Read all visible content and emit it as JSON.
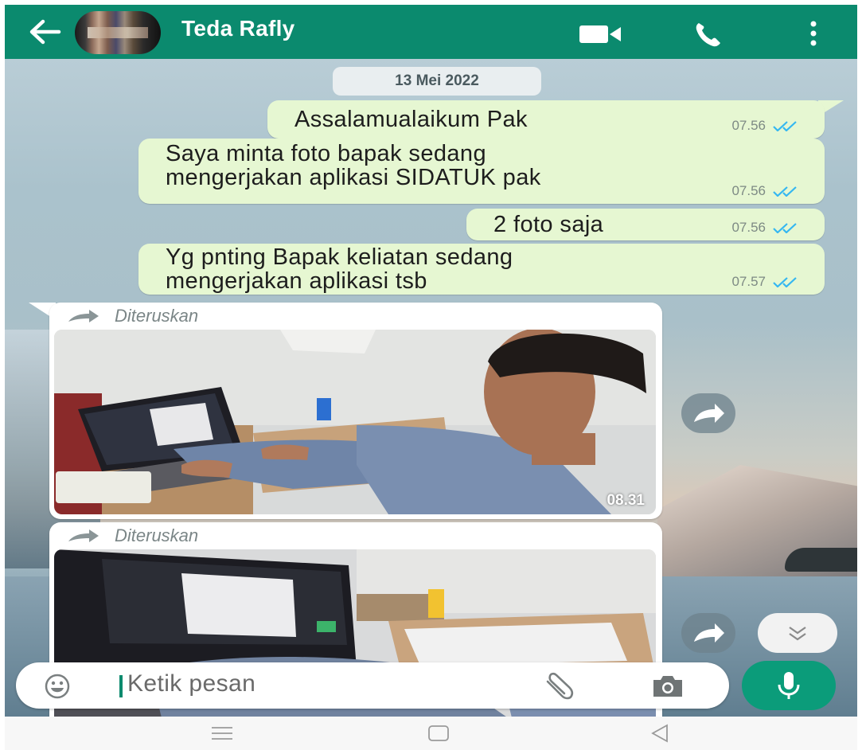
{
  "header": {
    "contact_name": "Teda Rafly",
    "color": "#0b8a6e",
    "icons": [
      "back-arrow-icon",
      "video-call-icon",
      "voice-call-icon",
      "more-options-icon"
    ]
  },
  "chat": {
    "date_label": "13 Mei 2022",
    "messages": [
      {
        "text": "Assalamualaikum Pak",
        "time": "07.56",
        "status": "read"
      },
      {
        "text": "Saya minta foto bapak sedang\nmengerjakan aplikasi SIDATUK pak",
        "time": "07.56",
        "status": "read"
      },
      {
        "text": "2 foto saja",
        "time": "07.56",
        "status": "read"
      },
      {
        "text": "Yg pnting Bapak keliatan sedang\nmengerjakan aplikasi tsb",
        "time": "07.57",
        "status": "read"
      }
    ],
    "forwarded": [
      {
        "label": "Diteruskan",
        "time": "08.31",
        "image": "man working on laptop at desk"
      },
      {
        "label": "Diteruskan",
        "image": "hands typing on laptop"
      }
    ],
    "bubble_color": "#e6f7d2",
    "tick_color": "#34b7f1"
  },
  "composer": {
    "placeholder": "Ketik pesan",
    "icons": [
      "emoji-icon",
      "attach-icon",
      "camera-icon",
      "mic-icon"
    ],
    "mic_color": "#0b9c7a"
  },
  "nav": {
    "icons": [
      "recent-apps-icon",
      "home-icon",
      "back-icon"
    ]
  }
}
